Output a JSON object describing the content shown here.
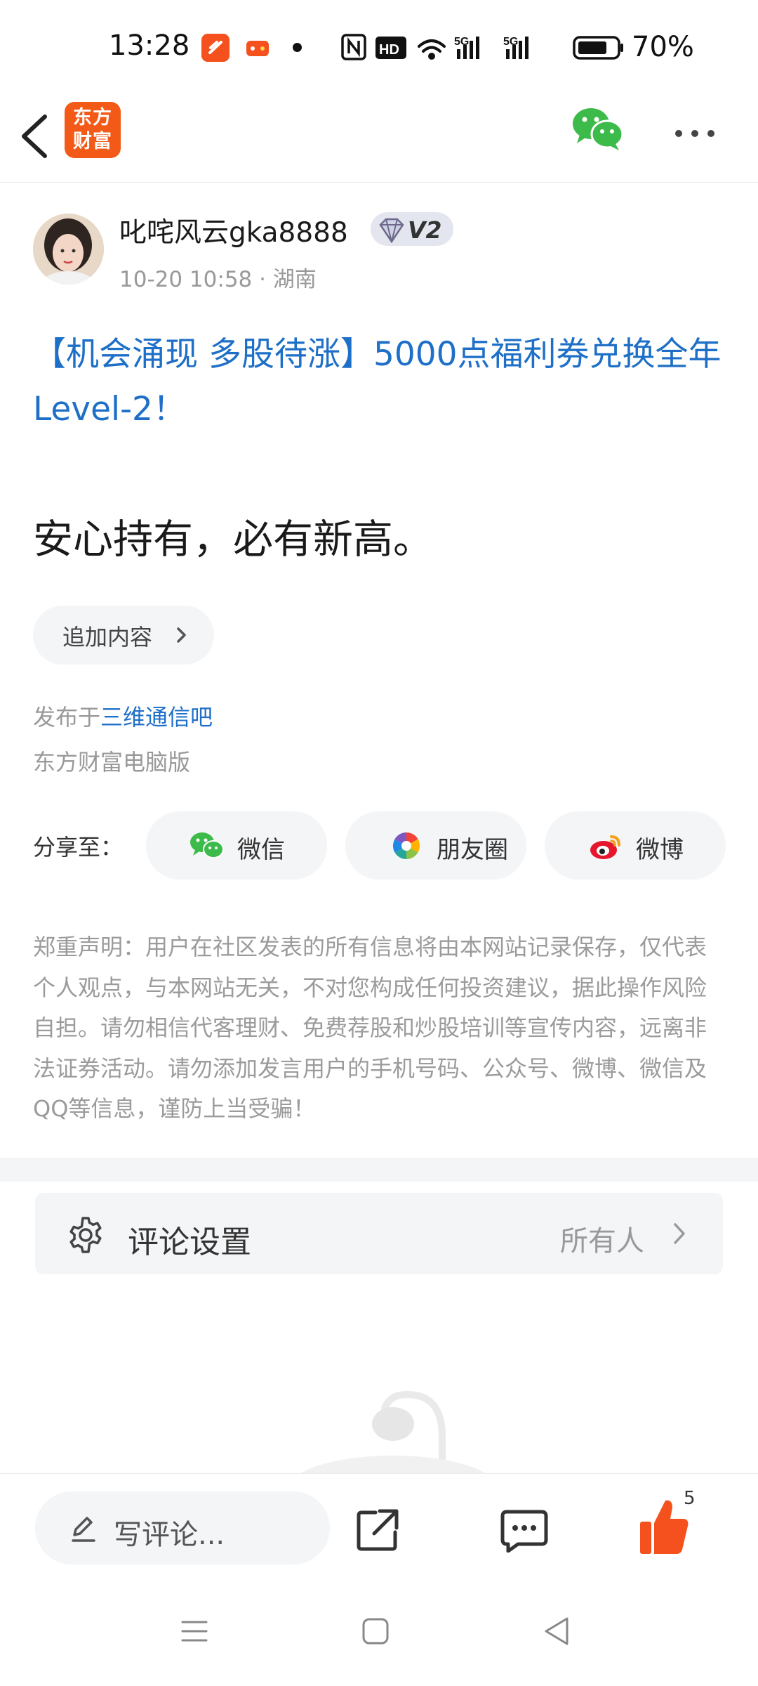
{
  "status_bar": {
    "time": "13:28",
    "battery": "70%",
    "icons": [
      "app-notification-icon",
      "game-app-icon",
      "dot-icon",
      "nfc-icon",
      "hd-icon",
      "wifi-icon",
      "signal-5g-icon",
      "signal-5g-icon",
      "battery-icon"
    ]
  },
  "header": {
    "logo_line1": "东方",
    "logo_line2": "财富",
    "icons": [
      "back-icon",
      "wechat-icon",
      "more-icon"
    ]
  },
  "post": {
    "author": "叱咤风云gka8888",
    "badge": "V2",
    "meta": "10-20 10:58 · 湖南",
    "title": "【机会涌现 多股待涨】5000点福利券兑换全年Level-2！",
    "body": "安心持有，必有新高。",
    "append_label": "追加内容",
    "posted_in_prefix": "发布于",
    "forum": "三维通信吧",
    "client": "东方财富电脑版"
  },
  "share": {
    "label": "分享至：",
    "buttons": [
      {
        "label": "微信",
        "icon": "wechat-icon"
      },
      {
        "label": "朋友圈",
        "icon": "moments-icon"
      },
      {
        "label": "微博",
        "icon": "weibo-icon"
      }
    ]
  },
  "disclaimer": "郑重声明：用户在社区发表的所有信息将由本网站记录保存，仅代表个人观点，与本网站无关，不对您构成任何投资建议，据此操作风险自担。请勿相信代客理财、免费荐股和炒股培训等宣传内容，远离非法证券活动。请勿添加发言用户的手机号码、公众号、微博、微信及QQ等信息，谨防上当受骗！",
  "comment_settings": {
    "label": "评论设置",
    "value": "所有人"
  },
  "bottom_bar": {
    "write_placeholder": "写评论...",
    "like_count": "5"
  },
  "colors": {
    "brand": "#f35a17",
    "link": "#1e6fc7",
    "like": "#f4511e",
    "wechat": "#3dbb4a"
  }
}
